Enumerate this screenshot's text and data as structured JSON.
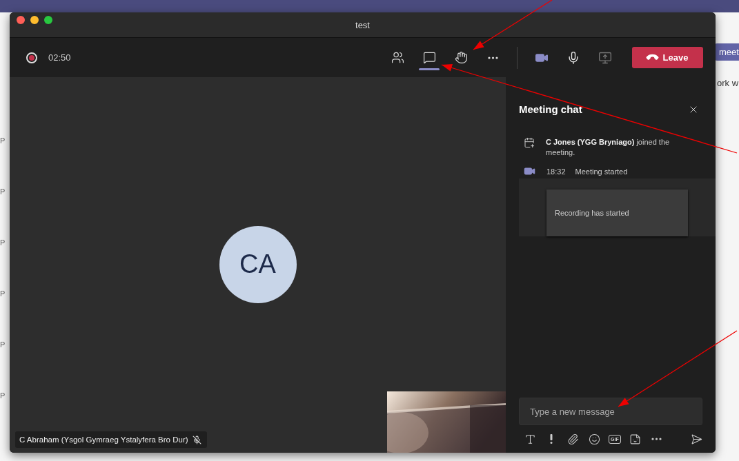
{
  "background_app": {
    "top_button": "meet",
    "text_fragment": "ork w",
    "time_labels": [
      "P",
      "P",
      "P",
      "P",
      "P",
      "P"
    ]
  },
  "window": {
    "title": "test"
  },
  "toolbar": {
    "recording": true,
    "timer": "02:50",
    "items": [
      {
        "kind": "people",
        "selected": false
      },
      {
        "kind": "chat",
        "selected": true
      },
      {
        "kind": "hand",
        "selected": false
      },
      {
        "kind": "more",
        "selected": false
      }
    ],
    "media": [
      {
        "kind": "camera",
        "disabled": false
      },
      {
        "kind": "mic",
        "disabled": false
      },
      {
        "kind": "share",
        "disabled": true
      }
    ],
    "leave": "Leave"
  },
  "stage": {
    "avatar_initials": "CA",
    "participant_name": "C Abraham (Ysgol Gymraeg Ystalyfera Bro Dur)",
    "muted": true
  },
  "chat": {
    "title": "Meeting chat",
    "events": [
      {
        "kind": "joined",
        "text": "**C Jones (YGG Bryniago)** joined the meeting."
      },
      {
        "kind": "started",
        "time": "18:32",
        "text": "Meeting started"
      }
    ],
    "recording_card": "Recording has started",
    "compose": {
      "placeholder": "Type a new message"
    },
    "tools": [
      {
        "kind": "format"
      },
      {
        "kind": "important"
      },
      {
        "kind": "attach"
      },
      {
        "kind": "emoji"
      },
      {
        "kind": "gif",
        "label": "GIF"
      },
      {
        "kind": "sticker"
      },
      {
        "kind": "more"
      }
    ]
  }
}
